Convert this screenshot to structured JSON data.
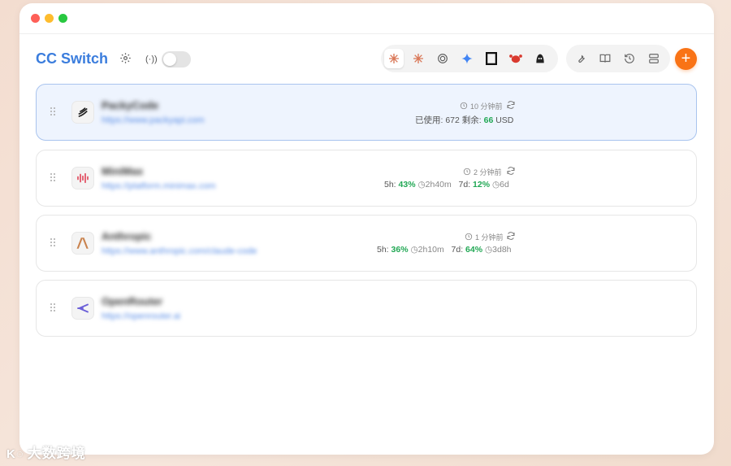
{
  "header": {
    "title": "CC Switch",
    "proxy_icon_glyph": "(·))"
  },
  "apps": [
    {
      "name": "claude-code-icon",
      "color": "#d97757"
    },
    {
      "name": "claude-desktop-icon",
      "color": "#d97757"
    },
    {
      "name": "openai-icon",
      "color": "#555555"
    },
    {
      "name": "gemini-icon",
      "color": "#4285f4"
    },
    {
      "name": "opencode-icon",
      "color": "#111111"
    },
    {
      "name": "crab-icon",
      "color": "#d93a2f"
    },
    {
      "name": "agent-icon",
      "color": "#222222"
    }
  ],
  "tools": [
    "wrench-icon",
    "book-icon",
    "history-icon",
    "server-icon"
  ],
  "add_label": "+",
  "providers": [
    {
      "name": "PackyCode",
      "url": "https://www.packyapi.com",
      "icon": "packy-icon",
      "time": "10 分钟前",
      "usage_prefix": "已使用: 672 剩余: ",
      "usage_remaining": "66",
      "usage_unit": " USD",
      "selected": true
    },
    {
      "name": "MiniMax",
      "url": "https://platform.minimax.com",
      "icon": "minimax-icon",
      "time": "2 分钟前",
      "h5_label": "5h:",
      "h5_pct": "43%",
      "h5_reset": "2h40m",
      "d7_label": "7d:",
      "d7_pct": "12%",
      "d7_reset": "6d",
      "selected": false
    },
    {
      "name": "Anthropic",
      "url": "https://www.anthropic.com/claude-code",
      "icon": "anthropic-icon",
      "time": "1 分钟前",
      "h5_label": "5h:",
      "h5_pct": "36%",
      "h5_reset": "2h10m",
      "d7_label": "7d:",
      "d7_pct": "64%",
      "d7_reset": "3d8h",
      "selected": false
    },
    {
      "name": "OpenRouter",
      "url": "https://openrouter.ai",
      "icon": "openrouter-icon",
      "selected": false
    }
  ],
  "watermark": "大数跨境"
}
